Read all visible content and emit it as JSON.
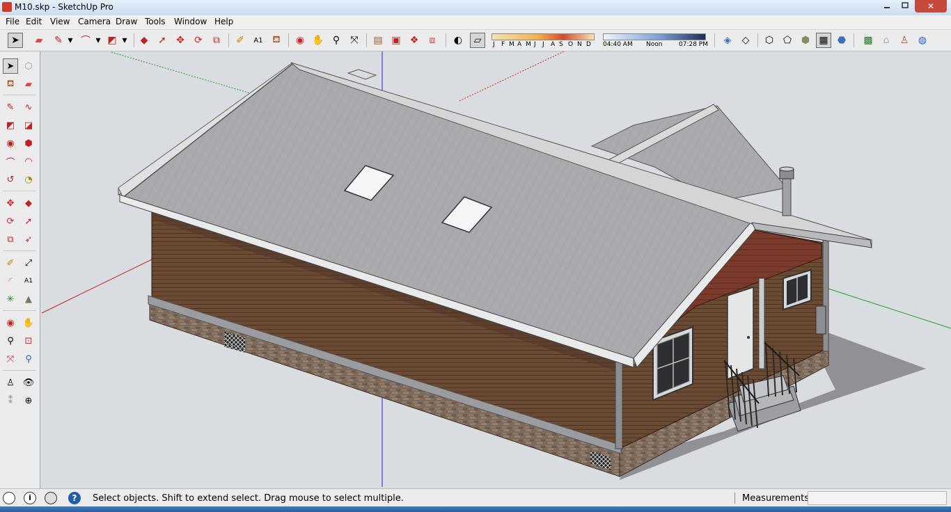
{
  "window": {
    "title": "M10.skp - SketchUp Pro",
    "minimize_icon": "minimize-icon",
    "maximize_icon": "maximize-icon",
    "close_glyph": "✕"
  },
  "menu": [
    "File",
    "Edit",
    "View",
    "Camera",
    "Draw",
    "Tools",
    "Window",
    "Help"
  ],
  "shadow_settings": {
    "months": [
      "J",
      "F",
      "M",
      "A",
      "M",
      "J",
      "J",
      "A",
      "S",
      "O",
      "N",
      "D"
    ],
    "time_start": "04:40 AM",
    "time_mid": "Noon",
    "time_end": "07:28 PM"
  },
  "status": {
    "hint": "Select objects. Shift to extend select. Drag mouse to select multiple.",
    "measurements_label": "Measurements",
    "measurements_value": "",
    "help_glyph": "?",
    "info_glyph": "i"
  },
  "colors": {
    "roof": "#a8aaad",
    "siding": "#6b4a33",
    "stone": "#7d6a5c",
    "sky": "#d9dce0",
    "shadow": "#8f9196",
    "axis_red": "#d42020",
    "axis_green": "#1aa01a",
    "axis_blue": "#2020d0"
  }
}
